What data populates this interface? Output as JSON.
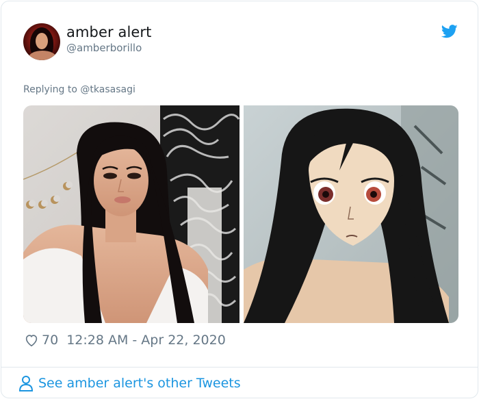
{
  "tweet": {
    "author_name": "amber alert",
    "author_handle": "@amberborillo",
    "replying_prefix": "Replying to ",
    "replying_to": "@tkasasagi",
    "likes": "70",
    "timestamp": "12:28 AM - Apr 22, 2020",
    "other_tweets_link": "See amber alert's other Tweets"
  },
  "images": [
    {
      "name": "real-photo",
      "subject": "young woman with long black hair in white top"
    },
    {
      "name": "anime-photo",
      "subject": "anime-style portrait of the same woman"
    }
  ],
  "colors": {
    "twitter_blue": "#1da1f2",
    "link_blue": "#1b95e0",
    "secondary_text": "#657786",
    "border": "#e1e8ed"
  },
  "icons": [
    "twitter-bird-icon",
    "heart-icon",
    "person-icon"
  ]
}
